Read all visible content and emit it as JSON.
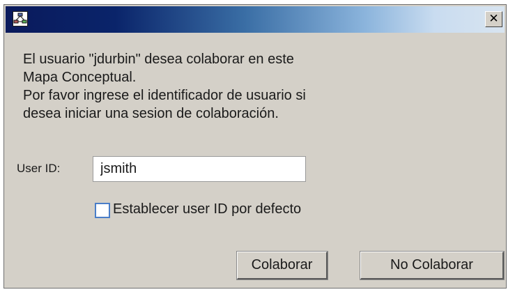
{
  "window": {
    "title": "",
    "icon": "concept-map-app-icon",
    "close_glyph": "✕"
  },
  "message": {
    "lines": [
      "El usuario \"jdurbin\" desea colaborar en este",
      "Mapa Conceptual.",
      "Por favor ingrese el identificador de usuario si",
      "desea iniciar una sesion de colaboración."
    ]
  },
  "form": {
    "userid_label": "User ID:",
    "userid_value": "jsmith",
    "default_checkbox_label": "Establecer user ID por defecto",
    "default_checkbox_checked": false
  },
  "buttons": {
    "colaborar": "Colaborar",
    "no_colaborar": "No Colaborar"
  },
  "colors": {
    "dialog_bg": "#d4d0c8",
    "title_gradient_start": "#0a246a",
    "title_gradient_end": "#d8e4f0",
    "checkbox_border": "#4a7ec8"
  }
}
